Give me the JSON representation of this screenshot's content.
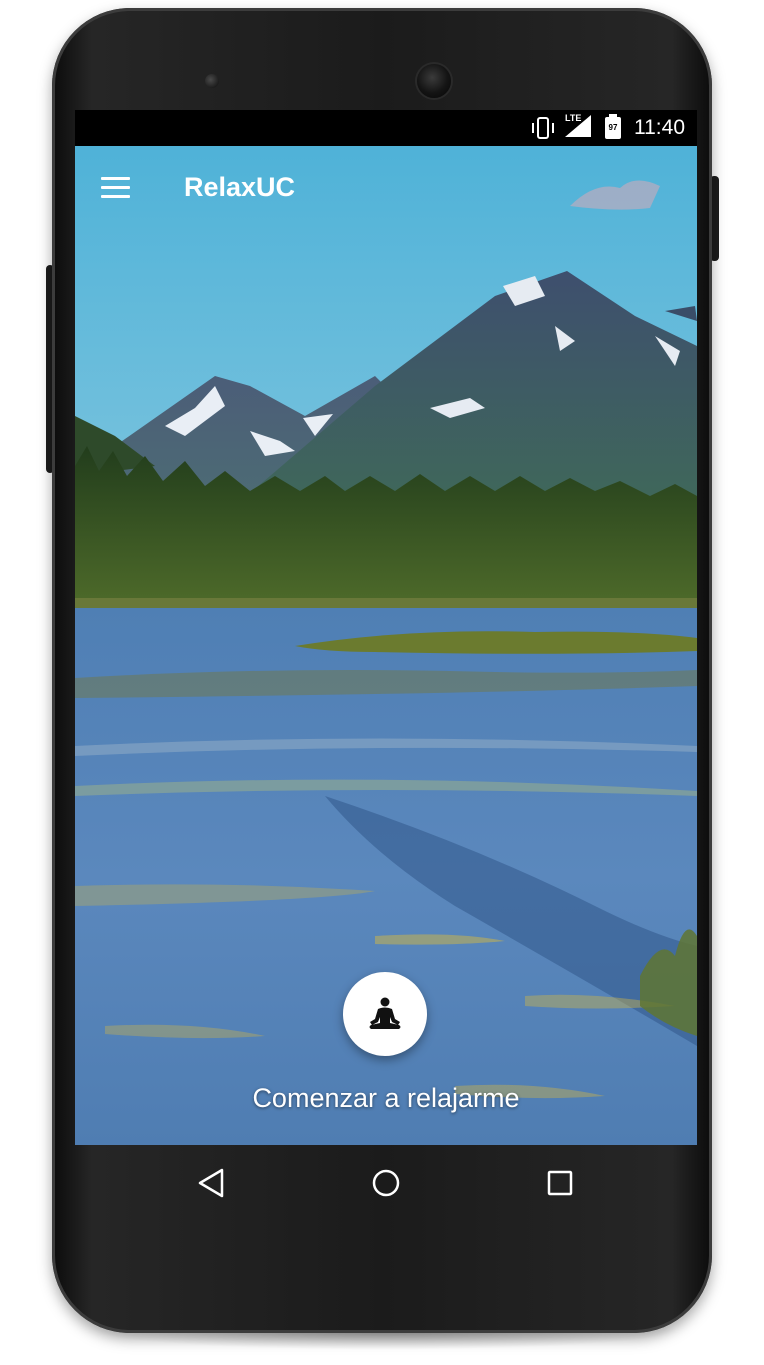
{
  "status_bar": {
    "time": "11:40",
    "battery_level": "97",
    "network_label": "LTE",
    "icons": [
      "vibrate-icon",
      "lte-signal-icon",
      "battery-icon"
    ]
  },
  "app_bar": {
    "title": "RelaxUC",
    "menu_icon": "hamburger-menu-icon"
  },
  "main": {
    "fab_icon": "meditation-icon",
    "start_label": "Comenzar a relajarme"
  },
  "nav_bar": {
    "icons": [
      "back-triangle-icon",
      "home-circle-icon",
      "recents-square-icon"
    ]
  },
  "colors": {
    "sky": "#5cb3d6",
    "water": "#3f6ea6",
    "forest": "#2f4f1f",
    "text": "#ffffff"
  }
}
